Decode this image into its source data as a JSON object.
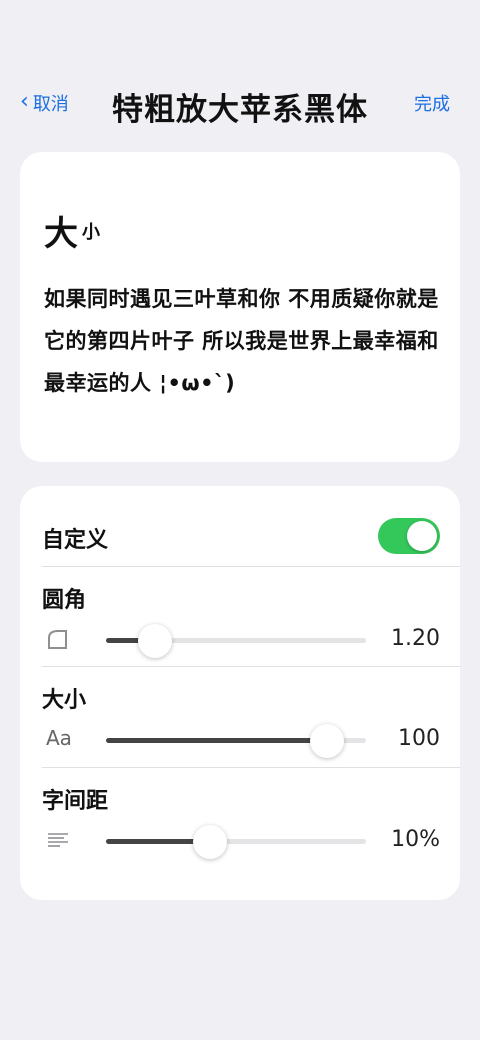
{
  "nav": {
    "cancel_label": "取消",
    "title": "特粗放大苹系黑体",
    "done_label": "完成"
  },
  "preview": {
    "size_big": "大",
    "size_small": "小",
    "sample_text": "如果同时遇见三叶草和你 不用质疑你就是它的第四片叶子 所以我是世界上最幸福和最幸运的人 ¦•ω•`)"
  },
  "settings": {
    "custom": {
      "label": "自定义",
      "enabled": true
    },
    "corner": {
      "label": "圆角",
      "value_text": "1.20",
      "level": 0.19
    },
    "size": {
      "label": "大小",
      "icon_text": "Aa",
      "value_text": "100",
      "level": 0.85
    },
    "spacing": {
      "label": "字间距",
      "value_text": "10%",
      "level": 0.4
    }
  },
  "colors": {
    "accent": "#1c6fe3",
    "toggle_on": "#34c759",
    "background": "#efeff4"
  }
}
